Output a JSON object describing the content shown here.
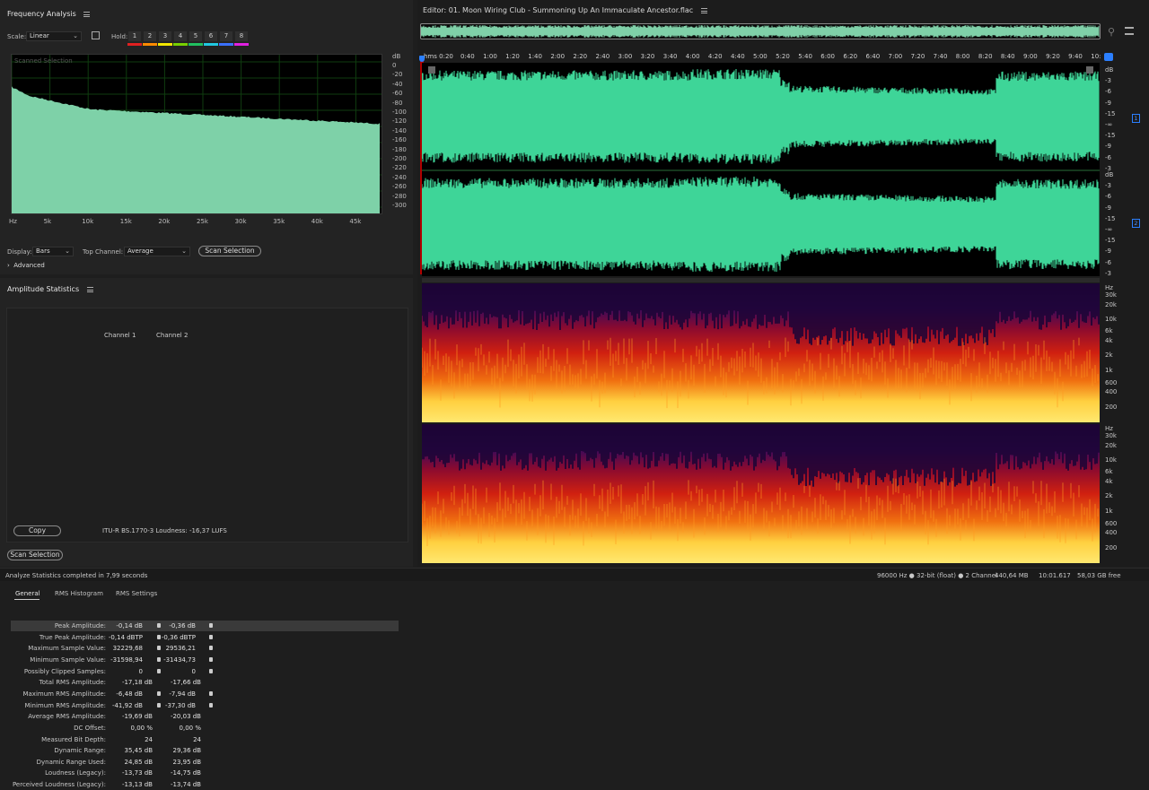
{
  "freq": {
    "title": "Frequency Analysis",
    "scale_label": "Scale:",
    "scale_value": "Linear",
    "hold_label": "Hold:",
    "hold_buttons": [
      "1",
      "2",
      "3",
      "4",
      "5",
      "6",
      "7",
      "8"
    ],
    "hold_colors": [
      "#e02020",
      "#ff8a00",
      "#f2e600",
      "#78d000",
      "#20c060",
      "#20c8e0",
      "#3a70ff",
      "#e020e0"
    ],
    "overlay_text": "Scanned Selection",
    "db_label": "dB",
    "db_ticks": [
      "0",
      "-20",
      "-40",
      "-60",
      "-80",
      "-100",
      "-120",
      "-140",
      "-160",
      "-180",
      "-200",
      "-220",
      "-240",
      "-260",
      "-280",
      "-300"
    ],
    "hz_ticks": [
      "Hz",
      "5k",
      "10k",
      "15k",
      "20k",
      "25k",
      "30k",
      "35k",
      "40k",
      "45k"
    ],
    "display_label": "Display:",
    "display_value": "Bars",
    "top_channel_label": "Top Channel:",
    "top_channel_value": "Average",
    "scan_button": "Scan Selection",
    "advanced": "Advanced"
  },
  "amp": {
    "title": "Amplitude Statistics",
    "tabs": [
      "General",
      "RMS Histogram",
      "RMS Settings"
    ],
    "col1": "Channel 1",
    "col2": "Channel 2",
    "rows": [
      {
        "k": "Peak Amplitude:",
        "v1": "-0,14 dB",
        "v2": "-0,36 dB",
        "pin": true
      },
      {
        "k": "True Peak Amplitude:",
        "v1": "-0,14 dBTP",
        "v2": "-0,36 dBTP",
        "pin": true
      },
      {
        "k": "Maximum Sample Value:",
        "v1": "32229,68",
        "v2": "29536,21",
        "pin": true
      },
      {
        "k": "Minimum Sample Value:",
        "v1": "-31598,94",
        "v2": "-31434,73",
        "pin": true
      },
      {
        "k": "Possibly Clipped Samples:",
        "v1": "0",
        "v2": "0",
        "pin": true
      },
      {
        "k": "Total RMS Amplitude:",
        "v1": "-17,18 dB",
        "v2": "-17,66 dB",
        "pin": false
      },
      {
        "k": "Maximum RMS Amplitude:",
        "v1": "-6,48 dB",
        "v2": "-7,94 dB",
        "pin": true
      },
      {
        "k": "Minimum RMS Amplitude:",
        "v1": "-41,92 dB",
        "v2": "-37,30 dB",
        "pin": true
      },
      {
        "k": "Average RMS Amplitude:",
        "v1": "-19,69 dB",
        "v2": "-20,03 dB",
        "pin": false
      },
      {
        "k": "DC Offset:",
        "v1": "0,00 %",
        "v2": "0,00 %",
        "pin": false
      },
      {
        "k": "Measured Bit Depth:",
        "v1": "24",
        "v2": "24",
        "pin": false
      },
      {
        "k": "Dynamic Range:",
        "v1": "35,45 dB",
        "v2": "29,36 dB",
        "pin": false
      },
      {
        "k": "Dynamic Range Used:",
        "v1": "24,85 dB",
        "v2": "23,95 dB",
        "pin": false
      },
      {
        "k": "Loudness (Legacy):",
        "v1": "-13,73 dB",
        "v2": "-14,75 dB",
        "pin": false
      },
      {
        "k": "Perceived Loudness (Legacy):",
        "v1": "-13,13 dB",
        "v2": "-13,74 dB",
        "pin": false
      }
    ],
    "copy_button": "Copy",
    "itu_text": "ITU-R BS.1770-3 Loudness: -16,37 LUFS",
    "scan_button": "Scan Selection"
  },
  "editor": {
    "title": "Editor: 01. Moon Wiring Club - Summoning Up An Immaculate Ancestor.flac",
    "time_ticks": [
      "hms 0:20",
      "0:40",
      "1:00",
      "1:20",
      "1:40",
      "2:00",
      "2:20",
      "2:40",
      "3:00",
      "3:20",
      "3:40",
      "4:00",
      "4:20",
      "4:40",
      "5:00",
      "5:20",
      "5:40",
      "6:00",
      "6:20",
      "6:40",
      "7:00",
      "7:20",
      "7:40",
      "8:00",
      "8:20",
      "8:40",
      "9:00",
      "9:20",
      "9:40",
      "10:"
    ],
    "db_ticks_ch1": [
      "dB",
      "-3",
      "-6",
      "-9",
      "-15",
      "-∞",
      "-15",
      "-9",
      "-6",
      "-3"
    ],
    "db_ticks_ch2": [
      "dB",
      "-3",
      "-6",
      "-9",
      "-15",
      "-∞",
      "-15",
      "-9",
      "-6",
      "-3"
    ],
    "channel_labels": [
      "1",
      "2"
    ],
    "hz_ticks_top": [
      "Hz",
      "30k",
      "20k",
      "10k",
      "6k",
      "4k",
      "2k",
      "1k",
      "600",
      "400",
      "200"
    ],
    "hz_ticks_bottom": [
      "Hz",
      "30k",
      "20k",
      "10k",
      "6k",
      "4k",
      "2k",
      "1k",
      "600",
      "400",
      "200"
    ]
  },
  "status": {
    "left": "Analyze Statistics completed in 7,99 seconds",
    "sample_info": "96000 Hz ● 32-bit (float) ● 2 Channel",
    "size": "440,64 MB",
    "duration": "10:01.617",
    "free": "58,03 GB free"
  },
  "colors": {
    "waveform": "#3ed598",
    "spectrum_bar": "#7ed1a8",
    "playhead": "#2b7fff"
  }
}
